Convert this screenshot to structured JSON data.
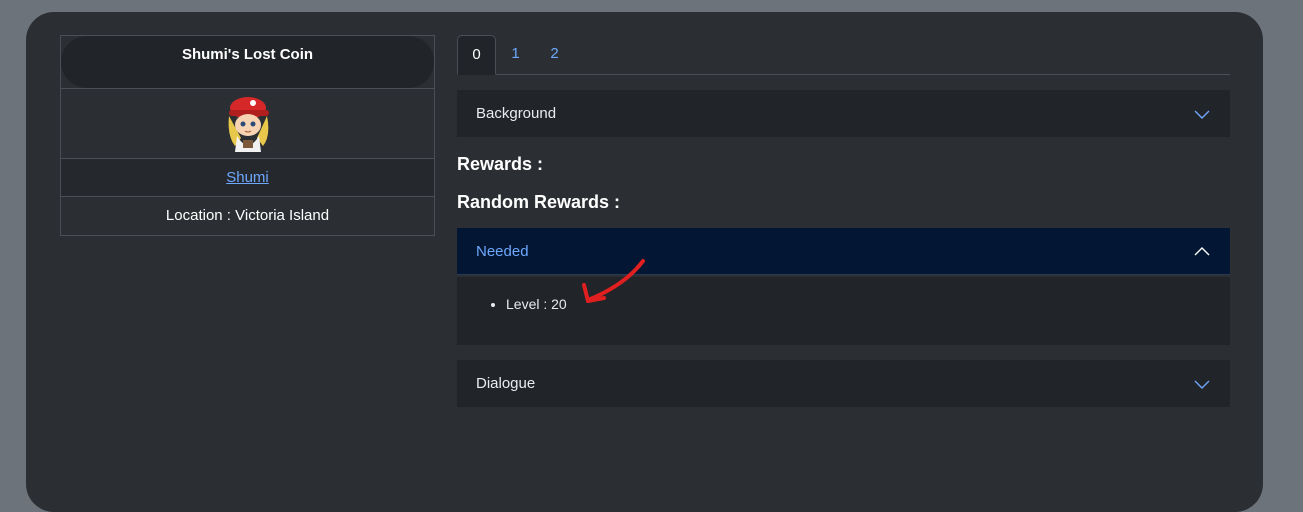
{
  "quest": {
    "title": "Shumi's Lost Coin",
    "npc_name": "Shumi",
    "location": "Location : Victoria Island"
  },
  "tabs": [
    "0",
    "1",
    "2"
  ],
  "sections": {
    "background_label": "Background",
    "rewards_heading": "Rewards :",
    "random_rewards_heading": "Random Rewards :",
    "needed_label": "Needed",
    "needed_items": [
      "Level : 20"
    ],
    "dialogue_label": "Dialogue"
  },
  "colors": {
    "page_bg": "#6c737b",
    "panel_bg": "#2b2f33",
    "link": "#6ea8fe",
    "annotation_arrow": "#e02020"
  }
}
